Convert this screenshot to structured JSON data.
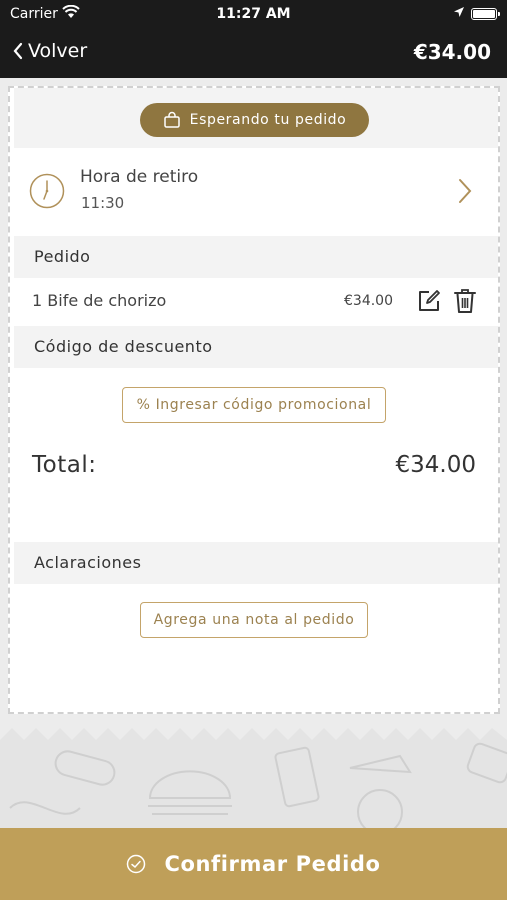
{
  "status_bar": {
    "carrier": "Carrier",
    "time": "11:27 AM"
  },
  "nav": {
    "back_label": "Volver",
    "total": "€34.00"
  },
  "order_status": {
    "label": "Esperando tu pedido"
  },
  "pickup": {
    "label": "Hora de retiro",
    "time": "11:30"
  },
  "sections": {
    "order": "Pedido",
    "discount": "Código de descuento",
    "notes": "Aclaraciones"
  },
  "items": [
    {
      "name": "1 Bife de chorizo",
      "price": "€34.00"
    }
  ],
  "promo_button": "% Ingresar código promocional",
  "totals": {
    "label": "Total:",
    "value": "€34.00"
  },
  "note_button": "Agrega una nota al pedido",
  "confirm_button": "Confirmar Pedido",
  "colors": {
    "accent": "#bf9f59",
    "pill": "#8f7640",
    "bar": "#1b1b1b"
  }
}
